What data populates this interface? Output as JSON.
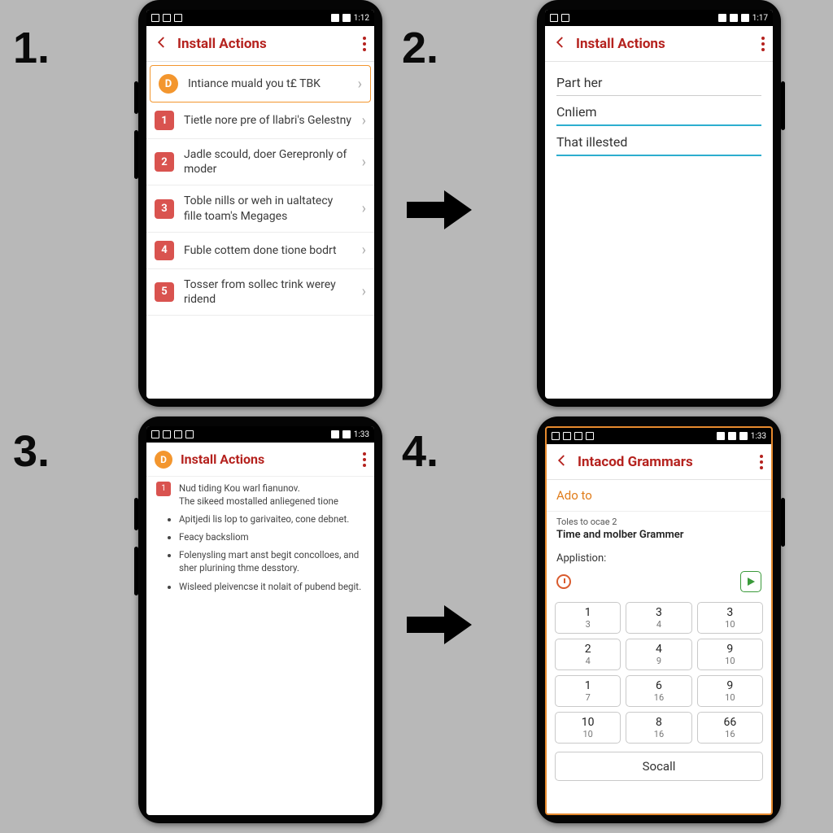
{
  "steps": [
    "1.",
    "2.",
    "3.",
    "4."
  ],
  "statusbar": {
    "t1": "1:12",
    "t2": "1:17",
    "t3": "1:33",
    "t4": "1:33",
    "left_icons": [
      "a",
      "b",
      "c"
    ]
  },
  "appbar": {
    "title1": "Install Actions",
    "title2": "Install Actions",
    "title3": "Install Actions",
    "title4": "Intacod Grammars"
  },
  "s1": {
    "row0": "Intiance muald you t£ TBK",
    "rows": [
      {
        "num": "1",
        "text": "Tietle nore pre of llabri's Gelestny"
      },
      {
        "num": "2",
        "text": "Jadle scould, doer Gerepronly of moder"
      },
      {
        "num": "3",
        "text": "Toble nills or weh in ualtatecy fille toam's Megages"
      },
      {
        "num": "4",
        "text": "Fuble cottem done tione bodrt"
      },
      {
        "num": "5",
        "text": "Tosser from sollec trink werey ridend"
      }
    ]
  },
  "s2": {
    "fields": [
      {
        "label": "Part her",
        "active": false
      },
      {
        "label": "Cnliem",
        "active": true
      },
      {
        "label": "That illested",
        "active": true
      }
    ]
  },
  "s3": {
    "numline_num": "1",
    "numline_top": "Nud tiding Kou warl fianunov.",
    "numline": "The sikeed mostalled anliegened tione",
    "bullets": [
      "Apitjedi lis lop to garivaiteo, cone debnet.",
      "Feacy backsliom",
      "Folenysling mart anst begit concolloes, and sher plurining thme desstory.",
      "Wisleed pleivencse it nolait of pubend begit."
    ]
  },
  "s4": {
    "addto": "Ado to",
    "small": "Toles to ocae 2",
    "med": "Time and molber Grammer",
    "label": "Applistion:",
    "keypad": [
      [
        "1",
        "3"
      ],
      [
        "3",
        "4"
      ],
      [
        "3",
        "10"
      ],
      [
        "2",
        "4"
      ],
      [
        "4",
        "9"
      ],
      [
        "9",
        "10"
      ],
      [
        "1",
        "7"
      ],
      [
        "6",
        "16"
      ],
      [
        "9",
        "10"
      ],
      [
        "10",
        "10"
      ],
      [
        "8",
        "16"
      ],
      [
        "66",
        "16"
      ]
    ],
    "socall": "Socall"
  }
}
